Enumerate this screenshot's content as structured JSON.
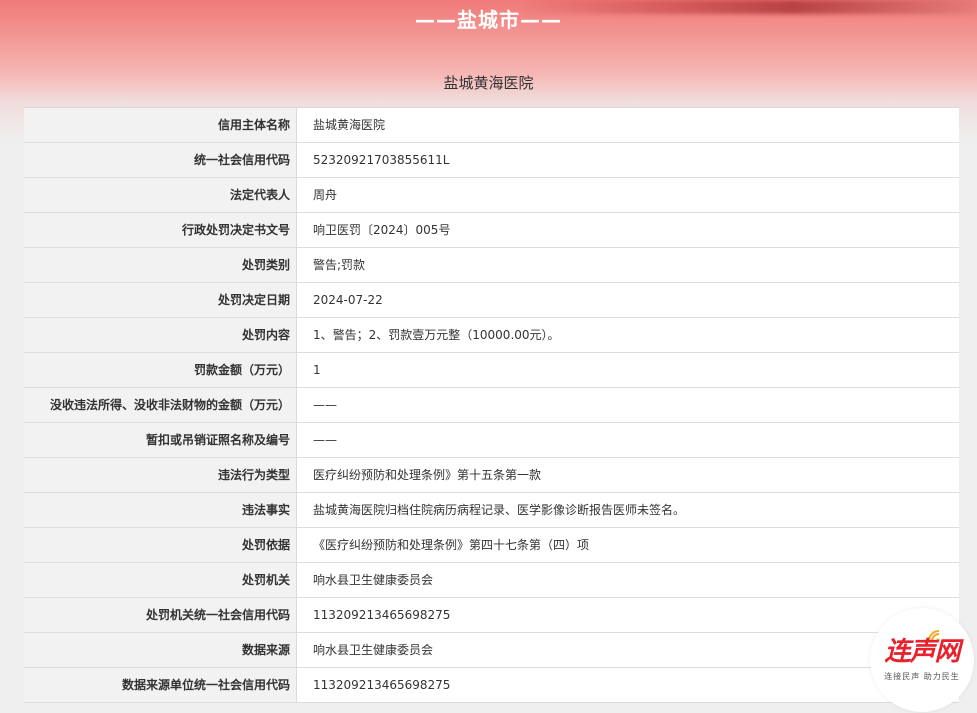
{
  "header": {
    "city": "——盐城市——",
    "organization": "盐城黄海医院"
  },
  "records": [
    {
      "label": "信用主体名称",
      "value": "盐城黄海医院"
    },
    {
      "label": "统一社会信用代码",
      "value": "52320921703855611L"
    },
    {
      "label": "法定代表人",
      "value": "周舟"
    },
    {
      "label": "行政处罚决定书文号",
      "value": "响卫医罚〔2024〕005号"
    },
    {
      "label": "处罚类别",
      "value": "警告;罚款"
    },
    {
      "label": "处罚决定日期",
      "value": "2024-07-22"
    },
    {
      "label": "处罚内容",
      "value": "1、警告；2、罚款壹万元整（10000.00元）。"
    },
    {
      "label": "罚款金额（万元）",
      "value": "1"
    },
    {
      "label": "没收违法所得、没收非法财物的金额（万元）",
      "value": "——"
    },
    {
      "label": "暂扣或吊销证照名称及编号",
      "value": "——"
    },
    {
      "label": "违法行为类型",
      "value": "医疗纠纷预防和处理条例》第十五条第一款"
    },
    {
      "label": "违法事实",
      "value": "盐城黄海医院归档住院病历病程记录、医学影像诊断报告医师未签名。"
    },
    {
      "label": "处罚依据",
      "value": "《医疗纠纷预防和处理条例》第四十七条第（四）项"
    },
    {
      "label": "处罚机关",
      "value": "响水县卫生健康委员会"
    },
    {
      "label": "处罚机关统一社会信用代码",
      "value": "113209213465698275"
    },
    {
      "label": "数据来源",
      "value": "响水县卫生健康委员会"
    },
    {
      "label": "数据来源单位统一社会信用代码",
      "value": "113209213465698275"
    }
  ],
  "watermark": {
    "logo_text": "连声网",
    "slogan": "连接民声 助力民生",
    "brand_color": "#e8212c",
    "icon": "signal-wave-icon"
  },
  "colors": {
    "header_gradient_top": "#f07a78",
    "label_background": "#f2f2f2",
    "value_background": "#ffffff",
    "border": "#dcdcdc"
  }
}
